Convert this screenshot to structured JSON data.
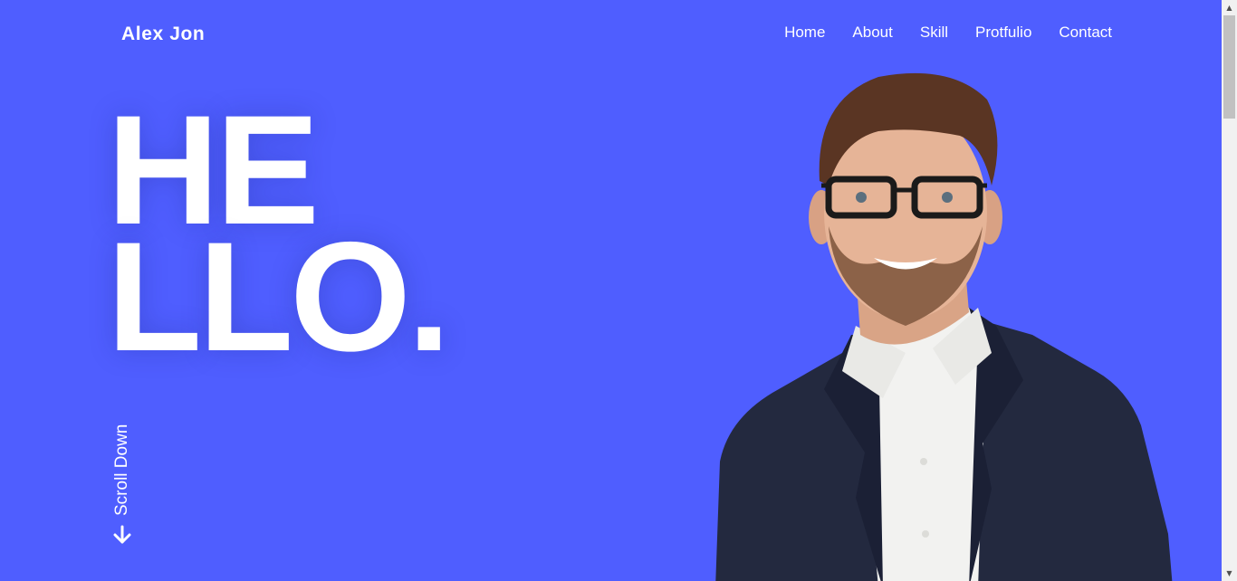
{
  "header": {
    "brand": "Alex Jon",
    "nav": [
      {
        "label": "Home"
      },
      {
        "label": "About"
      },
      {
        "label": "Skill"
      },
      {
        "label": "Protfulio"
      },
      {
        "label": "Contact"
      }
    ]
  },
  "hero": {
    "line1": "HE",
    "line2": "LLO.",
    "scroll_label": "Scroll Down",
    "scroll_icon": "arrow-down-icon"
  },
  "colors": {
    "background": "#4f5eff",
    "text": "#ffffff",
    "jacket": "#23293f",
    "shirt": "#f2f2f0"
  }
}
